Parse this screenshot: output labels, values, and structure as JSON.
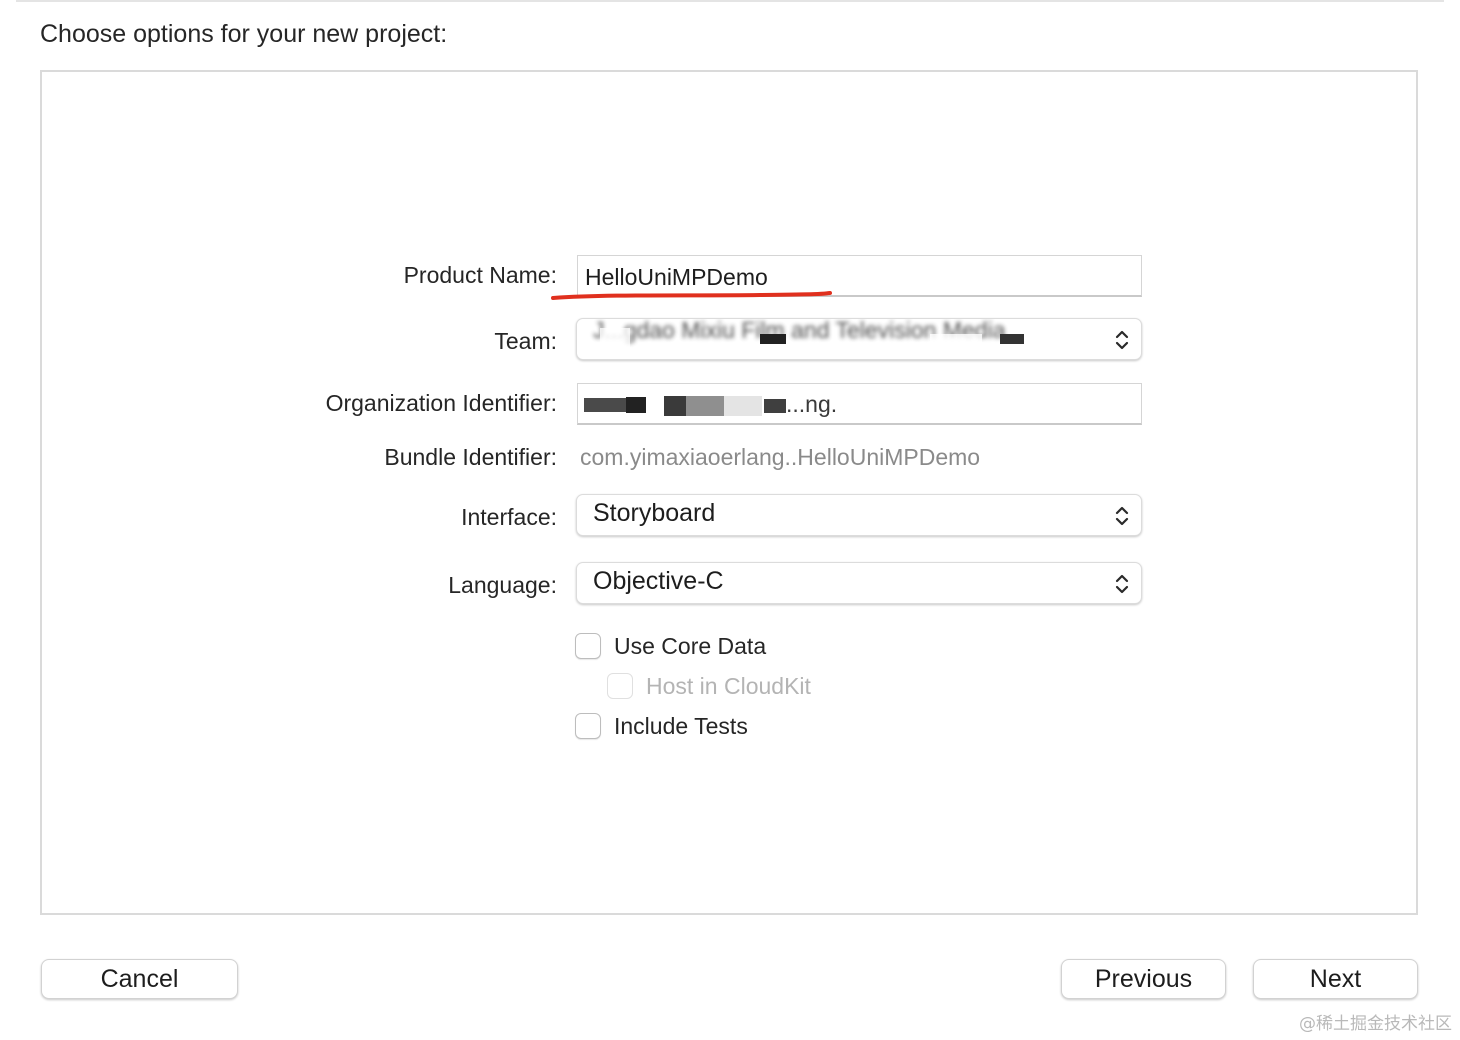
{
  "dialog": {
    "heading": "Choose options for your new project:"
  },
  "form": {
    "product_name": {
      "label": "Product Name:",
      "value": "HelloUniMPDemo"
    },
    "team": {
      "label": "Team:",
      "value": "J...gdao Mixiu Film and Television Media"
    },
    "organization_identifier": {
      "label": "Organization Identifier:",
      "value": "...ng."
    },
    "bundle_identifier": {
      "label": "Bundle Identifier:",
      "value": "com.yimaxiaoerlang..HelloUniMPDemo"
    },
    "interface": {
      "label": "Interface:",
      "value": "Storyboard"
    },
    "language": {
      "label": "Language:",
      "value": "Objective-C"
    },
    "checkboxes": {
      "use_core_data": {
        "label": "Use Core Data",
        "checked": false
      },
      "host_in_cloudkit": {
        "label": "Host in CloudKit",
        "checked": false,
        "disabled": true
      },
      "include_tests": {
        "label": "Include Tests",
        "checked": false
      }
    }
  },
  "buttons": {
    "cancel": "Cancel",
    "previous": "Previous",
    "next": "Next"
  },
  "annotation": {
    "underline_color": "#e0301e"
  },
  "watermark": "@稀土掘金技术社区"
}
